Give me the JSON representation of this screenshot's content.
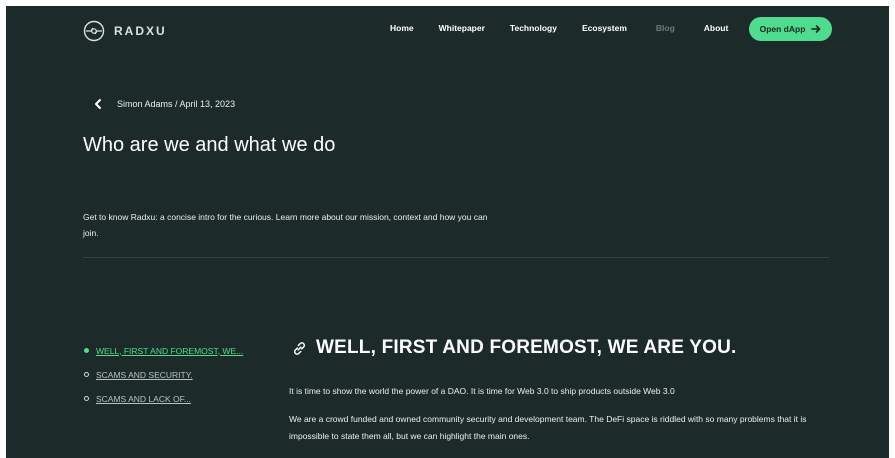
{
  "header": {
    "brand": "RADXU",
    "nav": [
      {
        "label": "Home",
        "muted": false
      },
      {
        "label": "Whitepaper",
        "muted": false
      },
      {
        "label": "Technology",
        "muted": false
      },
      {
        "label": "Ecosystem",
        "muted": false
      },
      {
        "label": "Blog",
        "muted": true
      },
      {
        "label": "About",
        "muted": false
      }
    ],
    "cta_label": "Open dApp"
  },
  "post": {
    "meta": "Simon Adams / April 13, 2023",
    "title": "Who are we and what we do",
    "intro": "Get to know Radxu: a concise intro for the curious. Learn more about our mission, context and how you can join."
  },
  "toc": [
    {
      "label": "WELL, FIRST AND FOREMOST, WE...",
      "active": true
    },
    {
      "label": "SCAMS AND SECURITY.",
      "active": false
    },
    {
      "label": "SCAMS AND LACK OF...",
      "active": false
    }
  ],
  "article": {
    "heading": "WELL, FIRST AND FOREMOST, WE ARE YOU.",
    "paragraphs": [
      "It is time to show the world the power of a DAO. It is time for Web 3.0 to ship products outside Web 3.0",
      "We are a crowd funded and owned community security and development team. The DeFi space is riddled with so many problems that it is impossible to state them all, but we can highlight the main ones."
    ]
  },
  "colors": {
    "background": "#1c2b2a",
    "accent": "#4fdc8e",
    "text": "#ffffff",
    "muted": "#6f7c79"
  },
  "icons": [
    "radxu-logo-icon",
    "arrow-right-icon",
    "chevron-left-icon",
    "link-icon"
  ]
}
